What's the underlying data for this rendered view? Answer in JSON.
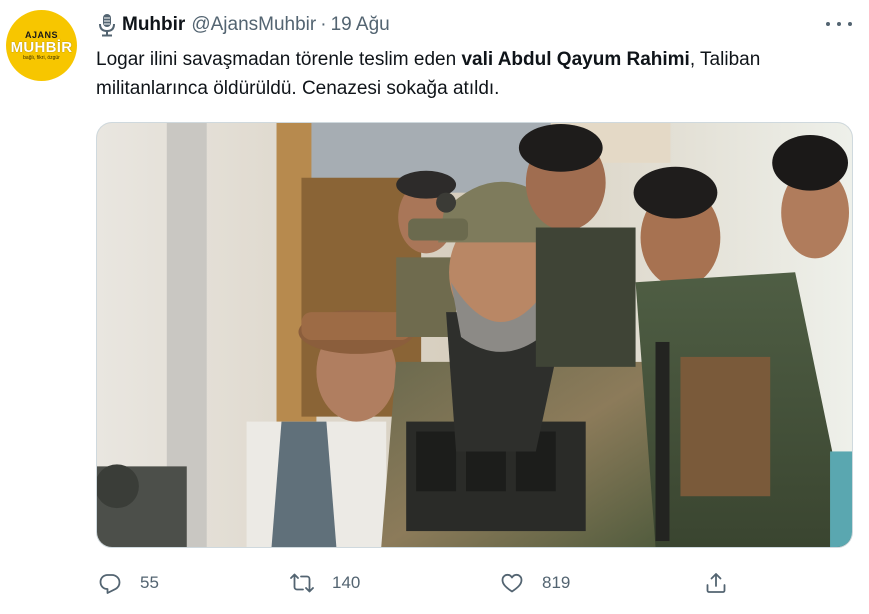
{
  "account": {
    "display_name": "Muhbir",
    "handle": "@AjansMuhbir",
    "separator": "·",
    "date": "19 Ağu",
    "avatar": {
      "line1": "AJANS",
      "line2": "MUHBİR",
      "tagline": "bağlı, fikri, özgür",
      "color": "#f7c600"
    },
    "badge_icon": "microphone-icon"
  },
  "tweet": {
    "text_before": "Logar ilini savaşmadan törenle teslim eden ",
    "text_bold": "vali Abdul Qayum Rahimi",
    "text_after": ", Taliban militanlarınca öldürüldü. Cenazesi sokağa atıldı."
  },
  "media": {
    "type": "photo",
    "icon": "photo"
  },
  "actions": {
    "reply_count": "55",
    "retweet_count": "140",
    "like_count": "819",
    "reply_icon": "reply-icon",
    "retweet_icon": "retweet-icon",
    "like_icon": "heart-icon",
    "share_icon": "share-icon"
  },
  "colors": {
    "text": "#0f1419",
    "secondary": "#536471",
    "border": "#cfd9de"
  }
}
